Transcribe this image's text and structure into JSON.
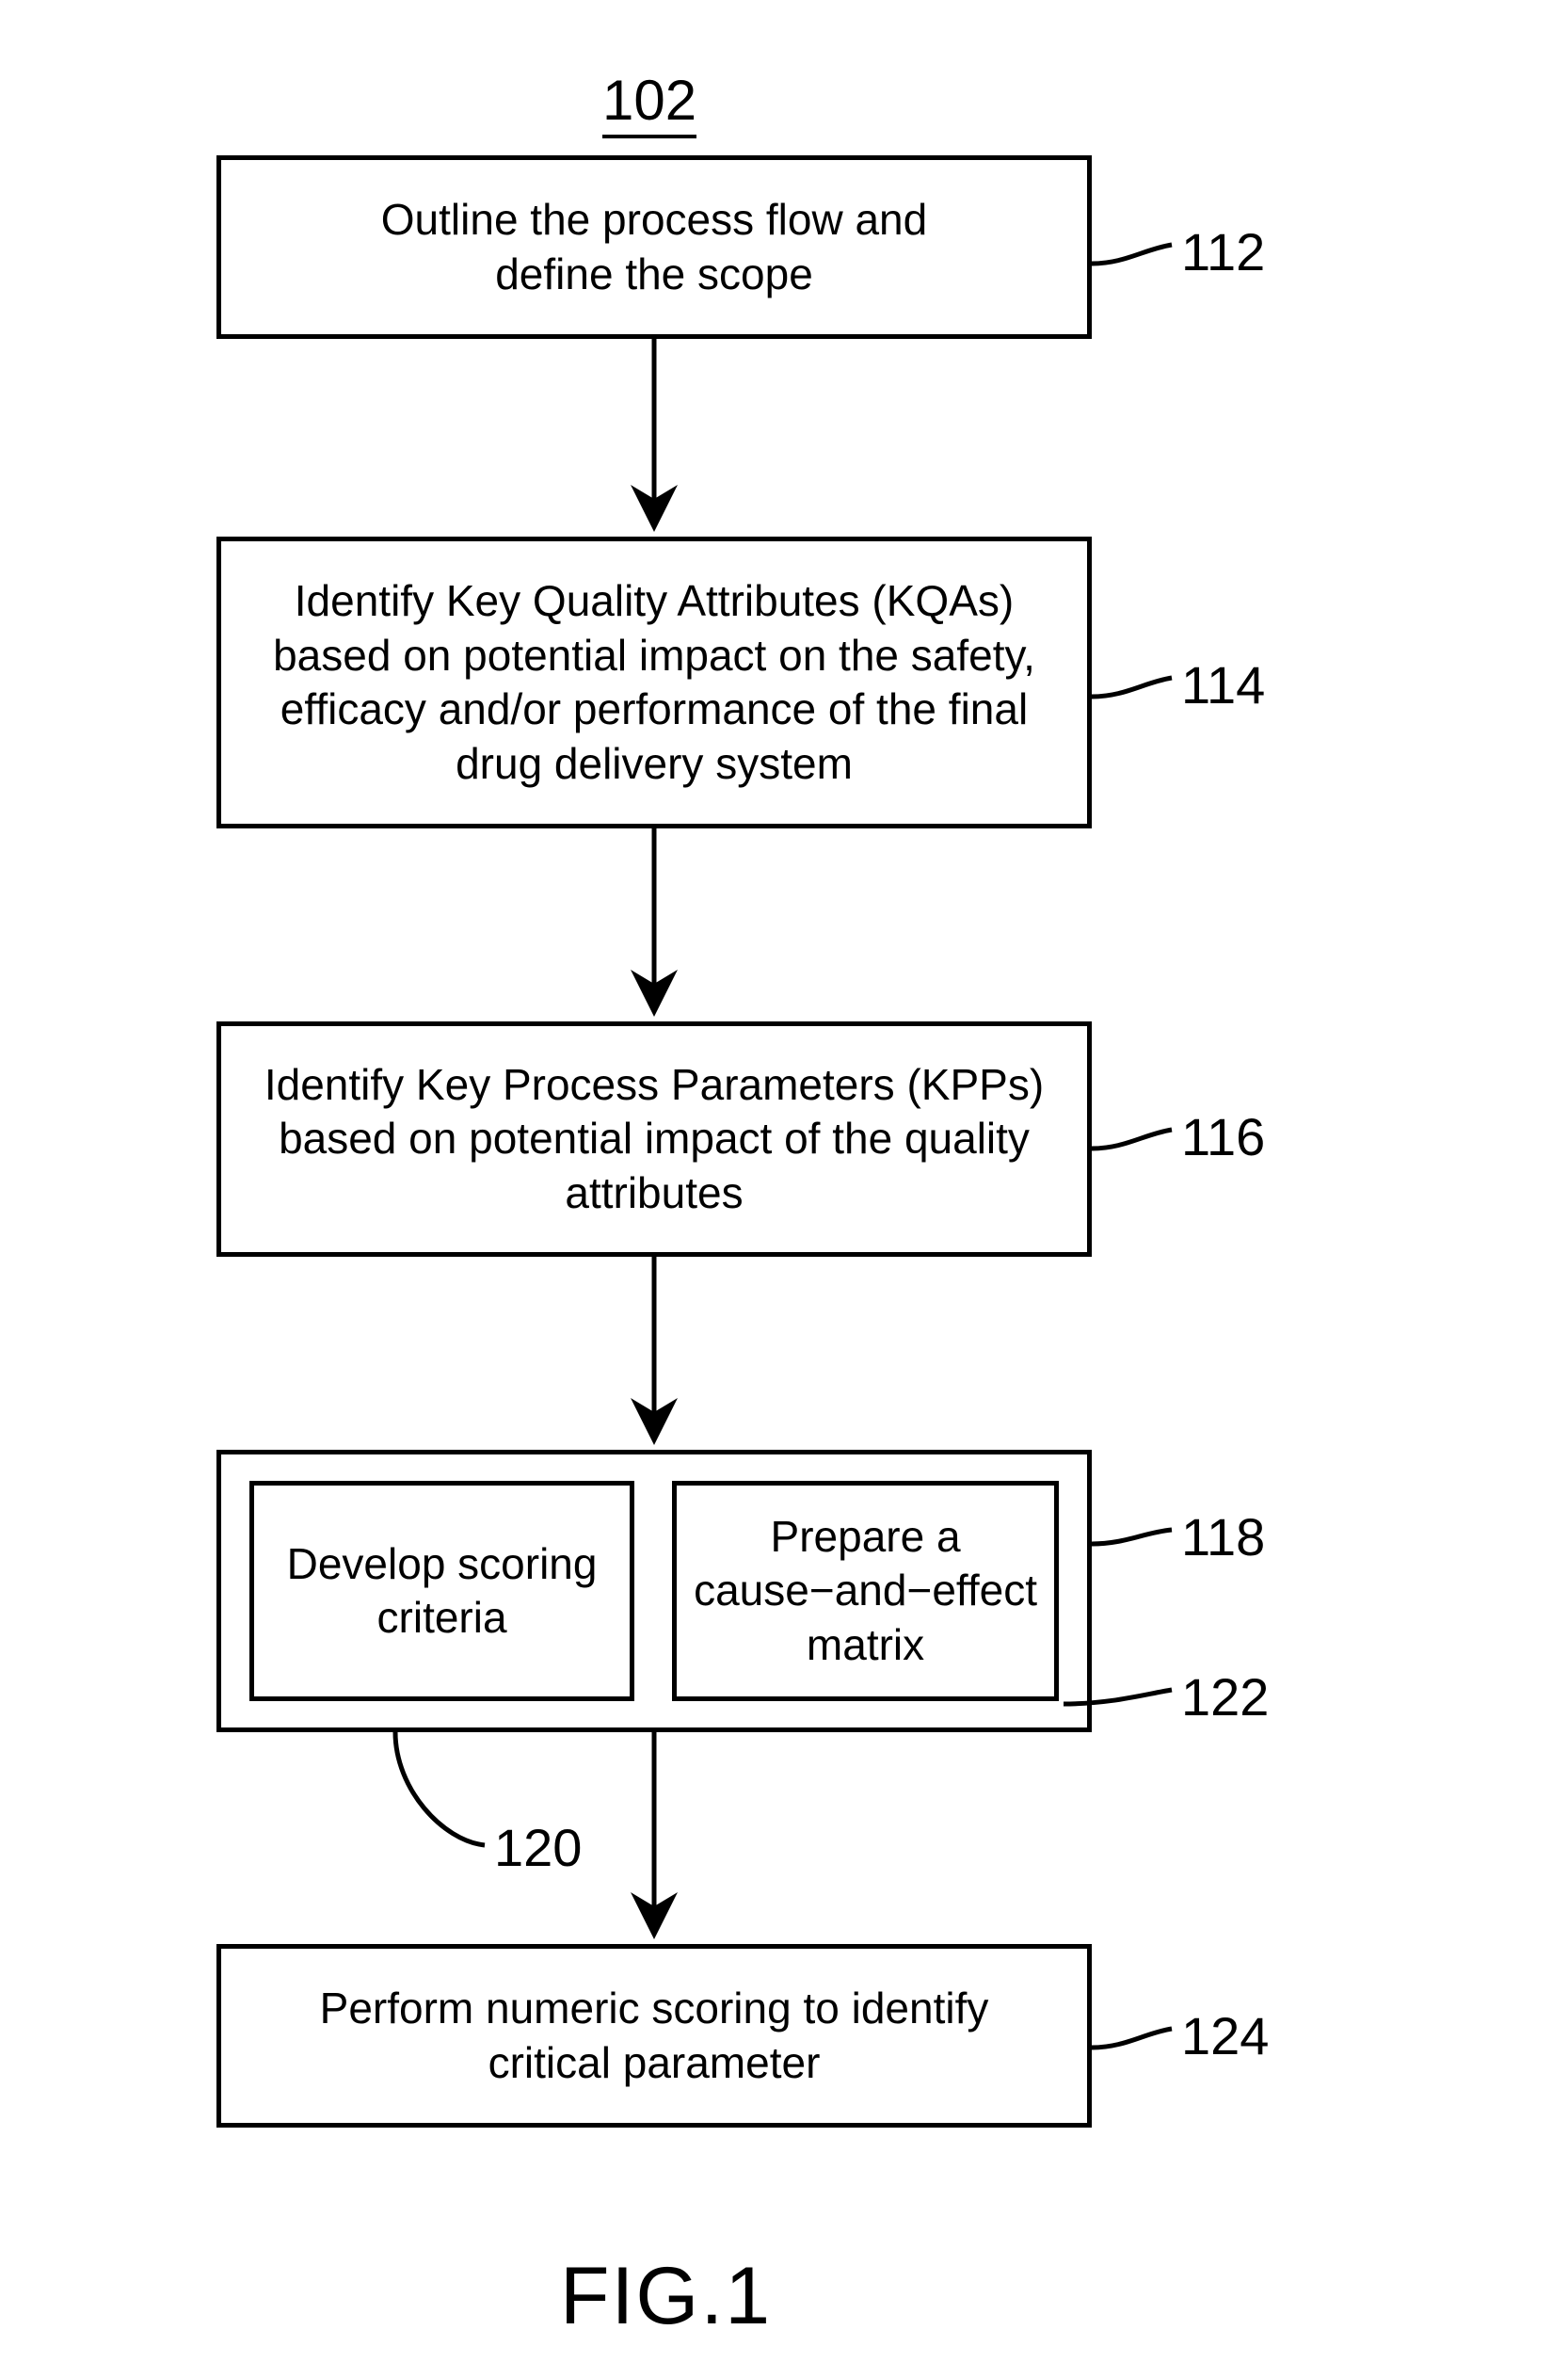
{
  "title_ref": "102",
  "figure_label": "FIG.1",
  "boxes": {
    "b112": {
      "text": "Outline the process flow and\ndefine the scope",
      "ref": "112"
    },
    "b114": {
      "text": "Identify Key Quality Attributes (KQAs)\nbased on potential impact on the safety,\nefficacy and/or performance of the final\ndrug delivery system",
      "ref": "114"
    },
    "b116": {
      "text": "Identify Key Process Parameters (KPPs)\nbased on potential impact of the quality\nattributes",
      "ref": "116"
    },
    "b118": {
      "ref": "118",
      "left": {
        "text": "Develop scoring\ncriteria",
        "ref": "120"
      },
      "right": {
        "text": "Prepare a\ncause−and−effect\nmatrix",
        "ref": "122"
      }
    },
    "b124": {
      "text": "Perform numeric scoring to identify\ncritical parameter",
      "ref": "124"
    }
  }
}
